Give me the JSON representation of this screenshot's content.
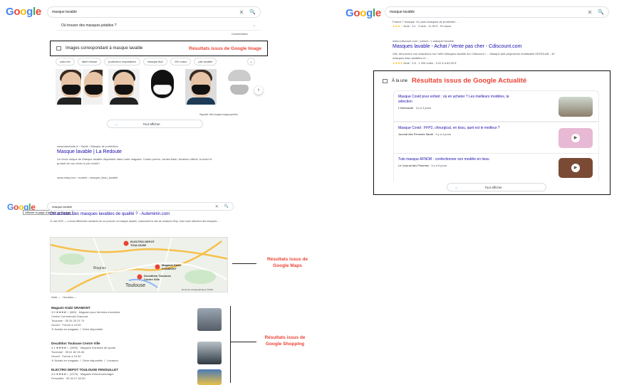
{
  "panel1": {
    "logo": "Google",
    "query": "masque lavable",
    "faq_question": "Où trouver des masques jetables ?",
    "comments": "Commentaires",
    "images_header": "Images correspondant à masque lavable",
    "images_annotation": "Résultats issus de Google Image",
    "chips": [
      "usko tex",
      "label blouse",
      "protection respiratoire",
      "masque ffp2",
      "100 coton",
      "pliz lavable"
    ],
    "report": "Signaler des images inappropriées",
    "show_all": "Tout afficher",
    "result_url": "www.laredoute.fr › Santé › Masque de protection",
    "result_title": "Masque lavable | La Redoute",
    "result_snippet": "Un choix unique de Masque lavable disponible dans notre magasin. Codes promo, ventes flash, livraison offerte, trouvez le produit de vos rêves à prix réduit !",
    "next_url": "www.ebay.com › market › masque_tissu_lavable"
  },
  "panel2": {
    "logo": "Google",
    "query": "masque lavable",
    "top_snippet": "France ? masque. Du plus masques de protection ...",
    "top_rating": "Note : 3,1 · 5 avis · 11,90 € · En stock",
    "result_url": "www.cdiscount.com › juniors › r-masque+lavable",
    "result_title": "Masques lavable - Achat / Vente pas cher - Cdiscount.com",
    "result_snippet": "Vite, découvrez nos réductions sur l'offre Masques lavable sur Cdiscount ! ... Masque anti-projections réutilisable HEROLAB - 10 masques tissu lavables et ...",
    "result_rating": "Note : 3,5 · 1 205 votes · 0,01 € à 83,00 €",
    "news_header": "À la une",
    "news_annotation": "Résultats issus de Google Actualité",
    "news": [
      {
        "title": "Masque Covid pour enfant : où en acheter ? Les meilleurs modèles, la sélection",
        "source": "L'Internaute",
        "time": "Il y a 3 jours"
      },
      {
        "title": "Masque Covid : FFP2, chirurgical, en tissu, quel est le meilleur ?",
        "source": "Journal des Femmes Santé",
        "time": "Il y a 4 jours"
      },
      {
        "title": "Tuto masque AFNOR : confectionner son modèle en tissu",
        "source": "Le Journal des Femmes",
        "time": "Il y a 5 jours"
      }
    ],
    "show_all": "Tout afficher"
  },
  "panel3": {
    "logo": "Google",
    "query": "masque lavable",
    "tooltip": "Afficher la page d'accueil de Google",
    "result_title": "Où acheter des masques lavables de qualité ? - Auteminin.com",
    "result_snippet": "11 mai 2020 — 4 seuls différentes manières de se procurer un masque lavable, notamment le site de créateurs Etsy. Voici notre sélection des masques ...",
    "map_labels": [
      "ELECTRO DEPOT TOULOUSE",
      "Magasin Kiabi GRAMONT",
      "Decathlon Toulouse Centre Ville",
      "Toulouse",
      "Blagnac"
    ],
    "map_credit": "Données cartographiques ©2020",
    "filters": [
      "Note",
      "Horaires"
    ],
    "maps_annotation": "Résultats issus de Google Maps",
    "shopping_annotation": "Résultats issus de Google Shopping",
    "stores": [
      {
        "name": "Magasin Kiabi GRAMONT",
        "rating": "3,5 ★★★★☆ (480) · Magasin pour femmes enceintes",
        "address": "Centre Commercial Gramont",
        "city": "Toulouse · 05 34 25 21 70",
        "hours": "Ouvert · Ferme à 19:00",
        "tags": "✕ Achats en magasin   ✓ Drive disponible"
      },
      {
        "name": "Decathlon Toulouse Centre Ville",
        "rating": "4,1 ★★★★☆ (1850) · Magasin d'articles de sports",
        "address": "Toulouse · 05 61 62 26 46",
        "city": "Ouvert · Ferme à 19:30",
        "hours": "",
        "tags": "✕ Achats en magasin   ✓ Drive disponible   ✓ Livraison"
      },
      {
        "name": "ELECTRO DEPOT TOULOUSE FENOUILLET",
        "rating": "3,5 ★★★★☆ (1375) · Magasin d'électroménager",
        "address": "Fenouillet · 05 34 27 63 60",
        "city": "",
        "hours": "",
        "tags": ""
      }
    ]
  }
}
